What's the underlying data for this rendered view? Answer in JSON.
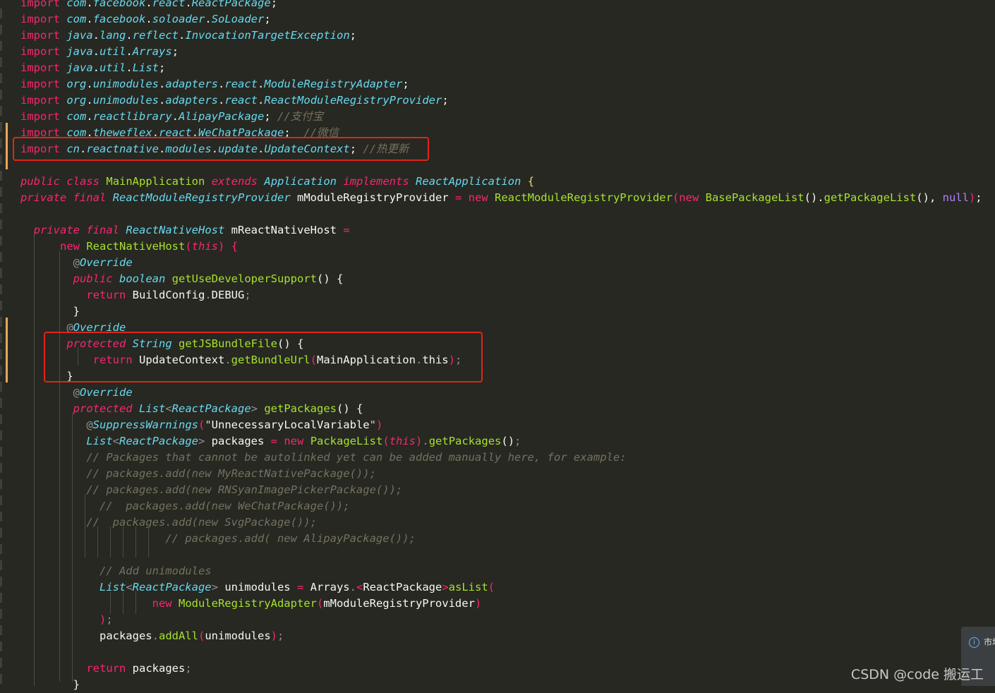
{
  "editor": {
    "theme_colors": {
      "background": "#272822",
      "keyword": "#f92672",
      "type": "#66d9ef",
      "function": "#a6e22e",
      "string": "#e6db74",
      "comment": "#75715e",
      "constant": "#ae81ff",
      "highlight_box": "#e0251b",
      "gutter_change": "#e8a85a"
    },
    "lines": [
      [
        [
          "kw",
          "import"
        ],
        [
          "pu",
          " "
        ],
        [
          "ty",
          "com"
        ],
        [
          "pu",
          "."
        ],
        [
          "ty",
          "facebook"
        ],
        [
          "pu",
          "."
        ],
        [
          "ty",
          "react"
        ],
        [
          "pu",
          "."
        ],
        [
          "ty",
          "ReactPackage"
        ],
        [
          "pu",
          ";"
        ]
      ],
      [
        [
          "kw",
          "import"
        ],
        [
          "pu",
          " "
        ],
        [
          "ty",
          "com"
        ],
        [
          "pu",
          "."
        ],
        [
          "ty",
          "facebook"
        ],
        [
          "pu",
          "."
        ],
        [
          "ty",
          "soloader"
        ],
        [
          "pu",
          "."
        ],
        [
          "ty",
          "SoLoader"
        ],
        [
          "pu",
          ";"
        ]
      ],
      [
        [
          "kw",
          "import"
        ],
        [
          "pu",
          " "
        ],
        [
          "ty",
          "java"
        ],
        [
          "pu",
          "."
        ],
        [
          "ty",
          "lang"
        ],
        [
          "pu",
          "."
        ],
        [
          "ty",
          "reflect"
        ],
        [
          "pu",
          "."
        ],
        [
          "ty",
          "InvocationTargetException"
        ],
        [
          "pu",
          ";"
        ]
      ],
      [
        [
          "kw",
          "import"
        ],
        [
          "pu",
          " "
        ],
        [
          "ty",
          "java"
        ],
        [
          "pu",
          "."
        ],
        [
          "ty",
          "util"
        ],
        [
          "pu",
          "."
        ],
        [
          "ty",
          "Arrays"
        ],
        [
          "pu",
          ";"
        ]
      ],
      [
        [
          "kw",
          "import"
        ],
        [
          "pu",
          " "
        ],
        [
          "ty",
          "java"
        ],
        [
          "pu",
          "."
        ],
        [
          "ty",
          "util"
        ],
        [
          "pu",
          "."
        ],
        [
          "ty",
          "List"
        ],
        [
          "pu",
          ";"
        ]
      ],
      [
        [
          "kw",
          "import"
        ],
        [
          "pu",
          " "
        ],
        [
          "ty",
          "org"
        ],
        [
          "pu",
          "."
        ],
        [
          "ty",
          "unimodules"
        ],
        [
          "pu",
          "."
        ],
        [
          "ty",
          "adapters"
        ],
        [
          "pu",
          "."
        ],
        [
          "ty",
          "react"
        ],
        [
          "pu",
          "."
        ],
        [
          "ty",
          "ModuleRegistryAdapter"
        ],
        [
          "pu",
          ";"
        ]
      ],
      [
        [
          "kw",
          "import"
        ],
        [
          "pu",
          " "
        ],
        [
          "ty",
          "org"
        ],
        [
          "pu",
          "."
        ],
        [
          "ty",
          "unimodules"
        ],
        [
          "pu",
          "."
        ],
        [
          "ty",
          "adapters"
        ],
        [
          "pu",
          "."
        ],
        [
          "ty",
          "react"
        ],
        [
          "pu",
          "."
        ],
        [
          "ty",
          "ReactModuleRegistryProvider"
        ],
        [
          "pu",
          ";"
        ]
      ],
      [
        [
          "kw",
          "import"
        ],
        [
          "pu",
          " "
        ],
        [
          "ty",
          "com"
        ],
        [
          "pu",
          "."
        ],
        [
          "ty",
          "reactlibrary"
        ],
        [
          "pu",
          "."
        ],
        [
          "ty",
          "AlipayPackage"
        ],
        [
          "pu",
          "; "
        ],
        [
          "cm",
          "//支付宝"
        ]
      ],
      [
        [
          "kw",
          "import"
        ],
        [
          "pu",
          " "
        ],
        [
          "ty",
          "com"
        ],
        [
          "pu",
          "."
        ],
        [
          "ty",
          "theweflex"
        ],
        [
          "pu",
          "."
        ],
        [
          "ty",
          "react"
        ],
        [
          "pu",
          "."
        ],
        [
          "ty",
          "WeChatPackage"
        ],
        [
          "pu",
          ";  "
        ],
        [
          "cm",
          "//微信"
        ]
      ],
      [
        [
          "kw",
          "import"
        ],
        [
          "pu",
          " "
        ],
        [
          "ty",
          "cn"
        ],
        [
          "pu",
          "."
        ],
        [
          "ty",
          "reactnative"
        ],
        [
          "pu",
          "."
        ],
        [
          "ty",
          "modules"
        ],
        [
          "pu",
          "."
        ],
        [
          "ty",
          "update"
        ],
        [
          "pu",
          "."
        ],
        [
          "ty",
          "UpdateContext"
        ],
        [
          "pu",
          "; "
        ],
        [
          "cm",
          "//热更新"
        ]
      ],
      [],
      [
        [
          "kwi",
          "public"
        ],
        [
          "pu",
          " "
        ],
        [
          "kwi",
          "class"
        ],
        [
          "pu",
          " "
        ],
        [
          "cl",
          "MainApplication"
        ],
        [
          "pu",
          " "
        ],
        [
          "kwi",
          "extends"
        ],
        [
          "pu",
          " "
        ],
        [
          "ty",
          "Application"
        ],
        [
          "pu",
          " "
        ],
        [
          "kwi",
          "implements"
        ],
        [
          "pu",
          " "
        ],
        [
          "ty",
          "ReactApplication"
        ],
        [
          "pu",
          " "
        ],
        [
          "br",
          "{"
        ]
      ],
      [
        [
          "kwi",
          "private"
        ],
        [
          "pu",
          " "
        ],
        [
          "kwi",
          "final"
        ],
        [
          "pu",
          " "
        ],
        [
          "ty",
          "ReactModuleRegistryProvider"
        ],
        [
          "pu",
          " mModuleRegistryProvider "
        ],
        [
          "kw",
          "="
        ],
        [
          "pu",
          " "
        ],
        [
          "kw",
          "new"
        ],
        [
          "pu",
          " "
        ],
        [
          "fn",
          "ReactModuleRegistryProvider"
        ],
        [
          "kw",
          "("
        ],
        [
          "kw",
          "new"
        ],
        [
          "pu",
          " "
        ],
        [
          "fn",
          "BasePackageList"
        ],
        [
          "pu",
          "()."
        ],
        [
          "fn",
          "getPackageList"
        ],
        [
          "pu",
          "(), "
        ],
        [
          "co",
          "null"
        ],
        [
          "kw",
          ")"
        ],
        [
          "pu",
          ";"
        ]
      ],
      [],
      [
        [
          "pu",
          "  "
        ],
        [
          "kwi",
          "private"
        ],
        [
          "pu",
          " "
        ],
        [
          "kwi",
          "final"
        ],
        [
          "pu",
          " "
        ],
        [
          "ty",
          "ReactNativeHost"
        ],
        [
          "pu",
          " mReactNativeHost "
        ],
        [
          "kw",
          "="
        ]
      ],
      [
        [
          "pu",
          "      "
        ],
        [
          "kw",
          "new"
        ],
        [
          "pu",
          " "
        ],
        [
          "fn",
          "ReactNativeHost"
        ],
        [
          "kw",
          "("
        ],
        [
          "kwi",
          "this"
        ],
        [
          "kw",
          ")"
        ],
        [
          "pu",
          " "
        ],
        [
          "kw",
          "{"
        ]
      ],
      [
        [
          "pu",
          "        "
        ],
        [
          "dim",
          "@"
        ],
        [
          "an",
          "Override"
        ]
      ],
      [
        [
          "pu",
          "        "
        ],
        [
          "kwi",
          "public"
        ],
        [
          "pu",
          " "
        ],
        [
          "ty",
          "boolean"
        ],
        [
          "pu",
          " "
        ],
        [
          "fn",
          "getUseDeveloperSupport"
        ],
        [
          "pu",
          "() "
        ],
        [
          "pu",
          "{"
        ]
      ],
      [
        [
          "pu",
          "          "
        ],
        [
          "kw",
          "return"
        ],
        [
          "pu",
          " BuildConfig"
        ],
        [
          "dim",
          "."
        ],
        [
          "pu",
          "DEBUG"
        ],
        [
          "dim",
          ";"
        ]
      ],
      [
        [
          "pu",
          "        "
        ],
        [
          "pu",
          "}"
        ]
      ],
      [
        [
          "pu",
          "       "
        ],
        [
          "dim",
          "@"
        ],
        [
          "an",
          "Override"
        ]
      ],
      [
        [
          "pu",
          "       "
        ],
        [
          "kwi",
          "protected"
        ],
        [
          "pu",
          " "
        ],
        [
          "ty",
          "String"
        ],
        [
          "pu",
          " "
        ],
        [
          "fn",
          "getJSBundleFile"
        ],
        [
          "pu",
          "() {"
        ]
      ],
      [
        [
          "pu",
          "           "
        ],
        [
          "kw",
          "return"
        ],
        [
          "pu",
          " UpdateContext"
        ],
        [
          "dim",
          "."
        ],
        [
          "fn",
          "getBundleUrl"
        ],
        [
          "kw",
          "("
        ],
        [
          "pu",
          "MainApplication"
        ],
        [
          "dim",
          "."
        ],
        [
          "pu",
          "this"
        ],
        [
          "kw",
          ")"
        ],
        [
          "dim",
          ";"
        ]
      ],
      [
        [
          "pu",
          "       "
        ],
        [
          "pu",
          "}"
        ]
      ],
      [
        [
          "pu",
          "        "
        ],
        [
          "dim",
          "@"
        ],
        [
          "an",
          "Override"
        ]
      ],
      [
        [
          "pu",
          "        "
        ],
        [
          "kwi",
          "protected"
        ],
        [
          "pu",
          " "
        ],
        [
          "ty",
          "List"
        ],
        [
          "dim",
          "<"
        ],
        [
          "ty",
          "ReactPackage"
        ],
        [
          "dim",
          ">"
        ],
        [
          "pu",
          " "
        ],
        [
          "fn",
          "getPackages"
        ],
        [
          "pu",
          "() {"
        ]
      ],
      [
        [
          "pu",
          "          "
        ],
        [
          "dim",
          "@"
        ],
        [
          "an",
          "SuppressWarnings"
        ],
        [
          "kw",
          "("
        ],
        [
          "st",
          "\""
        ],
        [
          "pu",
          "UnnecessaryLocalVariable"
        ],
        [
          "st",
          "\""
        ],
        [
          "kw",
          ")"
        ]
      ],
      [
        [
          "pu",
          "          "
        ],
        [
          "ty",
          "List"
        ],
        [
          "dim",
          "<"
        ],
        [
          "ty",
          "ReactPackage"
        ],
        [
          "dim",
          ">"
        ],
        [
          "pu",
          " packages "
        ],
        [
          "kw",
          "="
        ],
        [
          "pu",
          " "
        ],
        [
          "kw",
          "new"
        ],
        [
          "pu",
          " "
        ],
        [
          "fn",
          "PackageList"
        ],
        [
          "kw",
          "("
        ],
        [
          "kwi",
          "this"
        ],
        [
          "kw",
          ")"
        ],
        [
          "dim",
          "."
        ],
        [
          "fn",
          "getPackages"
        ],
        [
          "pu",
          "()"
        ],
        [
          "dim",
          ";"
        ]
      ],
      [
        [
          "pu",
          "          "
        ],
        [
          "cm",
          "// Packages that cannot be autolinked yet can be added manually here, for example:"
        ]
      ],
      [
        [
          "pu",
          "          "
        ],
        [
          "cm",
          "// packages.add(new MyReactNativePackage());"
        ]
      ],
      [
        [
          "pu",
          "          "
        ],
        [
          "cm",
          "// packages.add(new RNSyanImagePickerPackage());"
        ]
      ],
      [
        [
          "pu",
          "            "
        ],
        [
          "cm",
          "//  packages.add(new WeChatPackage());"
        ]
      ],
      [
        [
          "pu",
          "          "
        ],
        [
          "cm",
          "//  packages.add(new SvgPackage());"
        ]
      ],
      [
        [
          "pu",
          "                      "
        ],
        [
          "cm",
          "// packages.add( new AlipayPackage());"
        ]
      ],
      [],
      [
        [
          "pu",
          "            "
        ],
        [
          "cm",
          "// Add unimodules"
        ]
      ],
      [
        [
          "pu",
          "            "
        ],
        [
          "ty",
          "List"
        ],
        [
          "dim",
          "<"
        ],
        [
          "ty",
          "ReactPackage"
        ],
        [
          "dim",
          ">"
        ],
        [
          "pu",
          " unimodules "
        ],
        [
          "kw",
          "="
        ],
        [
          "pu",
          " Arrays"
        ],
        [
          "dim",
          "."
        ],
        [
          "kw",
          "<"
        ],
        [
          "pu",
          "ReactPackage"
        ],
        [
          "kw",
          ">"
        ],
        [
          "fn",
          "asList"
        ],
        [
          "kw",
          "("
        ]
      ],
      [
        [
          "pu",
          "                    "
        ],
        [
          "kw",
          "new"
        ],
        [
          "pu",
          " "
        ],
        [
          "fn",
          "ModuleRegistryAdapter"
        ],
        [
          "kw",
          "("
        ],
        [
          "pu",
          "mModuleRegistryProvider"
        ],
        [
          "kw",
          ")"
        ]
      ],
      [
        [
          "pu",
          "            "
        ],
        [
          "kw",
          ")"
        ],
        [
          "dim",
          ";"
        ]
      ],
      [
        [
          "pu",
          "            packages"
        ],
        [
          "dim",
          "."
        ],
        [
          "fn",
          "addAll"
        ],
        [
          "kw",
          "("
        ],
        [
          "pu",
          "unimodules"
        ],
        [
          "kw",
          ")"
        ],
        [
          "dim",
          ";"
        ]
      ],
      [],
      [
        [
          "pu",
          "          "
        ],
        [
          "kw",
          "return"
        ],
        [
          "pu",
          " packages"
        ],
        [
          "dim",
          ";"
        ]
      ],
      [
        [
          "pu",
          "        "
        ],
        [
          "pu",
          "}"
        ]
      ]
    ]
  },
  "notification": {
    "icon": "info-icon",
    "text": "市场"
  },
  "watermark": {
    "text": "CSDN @code 搬运工"
  }
}
